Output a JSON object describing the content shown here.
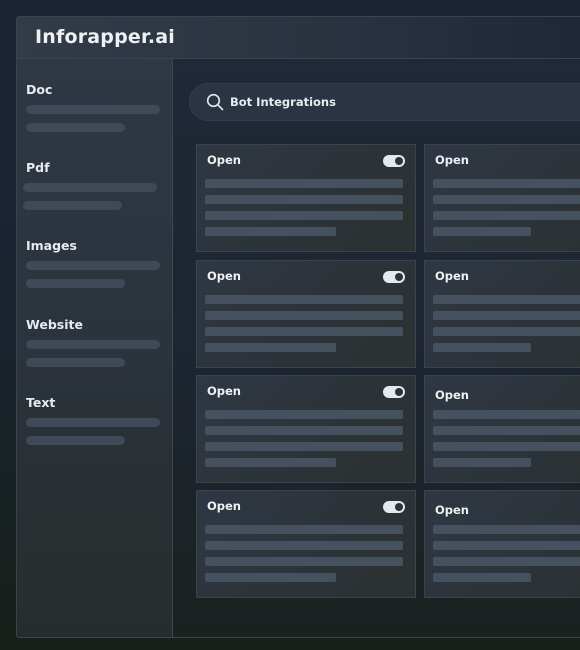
{
  "app": {
    "title": "Inforapper.ai"
  },
  "sidebar": {
    "items": [
      {
        "label": "Doc"
      },
      {
        "label": "Pdf"
      },
      {
        "label": "Images"
      },
      {
        "label": "Website"
      },
      {
        "label": "Text"
      }
    ]
  },
  "search": {
    "label": "Bot Integrations",
    "icon": "search-icon"
  },
  "cards": [
    {
      "title": "Open",
      "toggle_on": true
    },
    {
      "title": "Open"
    },
    {
      "title": "Open",
      "toggle_on": true
    },
    {
      "title": "Open"
    },
    {
      "title": "Open",
      "toggle_on": true
    },
    {
      "title": "Open"
    },
    {
      "title": "Open",
      "toggle_on": true
    },
    {
      "title": "Open"
    }
  ],
  "colors": {
    "background": "#1c2536",
    "sidebar": "#2e3744",
    "card": "#2f3744",
    "skeleton": "#3f4957",
    "toggle": "#e6e9ec"
  }
}
